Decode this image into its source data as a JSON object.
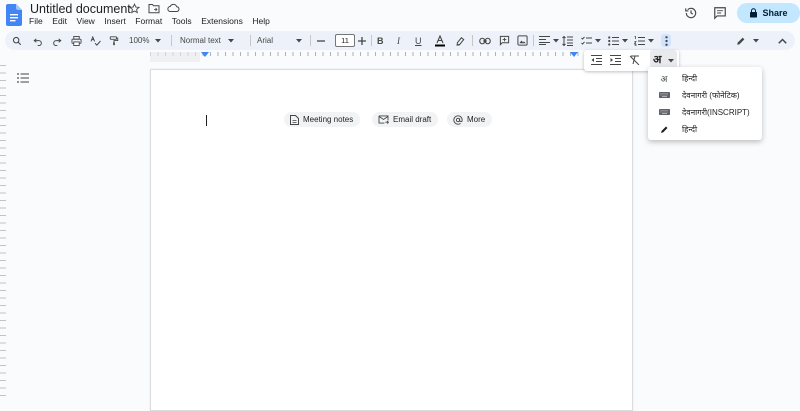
{
  "header": {
    "title": "Untitled document",
    "menu": [
      "File",
      "Edit",
      "View",
      "Insert",
      "Format",
      "Tools",
      "Extensions",
      "Help"
    ],
    "share_label": "Share"
  },
  "toolbar": {
    "zoom": "100%",
    "style": "Normal text",
    "font": "Arial",
    "font_size": "11"
  },
  "chips": [
    {
      "label": "Meeting notes",
      "icon": "doc-icon"
    },
    {
      "label": "Email draft",
      "icon": "mail-icon"
    },
    {
      "label": "More",
      "icon": "at-icon"
    }
  ],
  "input_tools": {
    "button_glyph": "अ",
    "items": [
      {
        "label": "हिन्दी",
        "icon": "devanagari-a-icon"
      },
      {
        "label": "देवनागरी (फोनेटिक)",
        "icon": "keyboard-icon"
      },
      {
        "label": "देवनागरी(INSCRIPT)",
        "icon": "keyboard-icon"
      },
      {
        "label": "हिन्दी",
        "icon": "pencil-icon"
      }
    ]
  },
  "colors": {
    "accent": "#1a73e8",
    "share_bg": "#c2e7ff",
    "toolbar_bg": "#edf2fa",
    "page_bg": "#f9fbfd"
  }
}
